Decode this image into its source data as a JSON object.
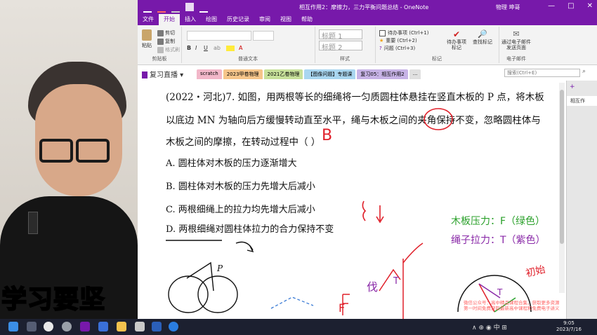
{
  "window": {
    "title": "相互作用2：摩擦力，三力平衡问题总结 - OneNote",
    "user": "物理 坤哥",
    "controls": [
      "—",
      "□",
      "✕"
    ]
  },
  "ribbon_tabs": [
    "文件",
    "开始",
    "插入",
    "绘图",
    "历史记录",
    "审阅",
    "视图",
    "帮助"
  ],
  "ribbon": {
    "paste": "粘贴",
    "cut": "剪切",
    "copy": "复制",
    "format_painter": "格式刷",
    "clipboard_label": "剪贴板",
    "basic_text_label": "普通文本",
    "heading1": "标题 1",
    "heading2": "标题 2",
    "styles_label": "样式",
    "tag1": "待办事项 (Ctrl+1)",
    "tag2": "重要 (Ctrl+2)",
    "tag3": "问题 (Ctrl+3)",
    "todo_tag": "待办事项标记",
    "find_tags": "查找标记",
    "tags_label": "标记",
    "email_page": "通过电子邮件发送页面",
    "email_label": "电子邮件"
  },
  "notebook": {
    "name": "复习直播",
    "sections": [
      {
        "label": "scratch",
        "color": "#f2b7c9"
      },
      {
        "label": "2023甲卷物理",
        "color": "#f6c58a"
      },
      {
        "label": "2021乙卷物理",
        "color": "#c7e09a"
      },
      {
        "label": "【图像问题】专题课",
        "color": "#a9d6f0"
      },
      {
        "label": "复习05：相互作用2",
        "color": "#c7b3e6"
      },
      {
        "label": "...",
        "color": "#e0e0e0"
      }
    ],
    "search_placeholder": "搜索(Ctrl+E)"
  },
  "page": {
    "line1": "(2022・河北)7. 如图，用两根等长的细绳将一匀质圆柱体悬挂在竖直木板的 P 点，将木板",
    "line2": "以底边 MN 为轴向后方缓慢转动直至水平，绳与木板之间的夹角保持不变，忽略圆柱体与",
    "line3": "木板之间的摩擦，在转动过程中（        ）",
    "answer": "B",
    "options": [
      "A.  圆柱体对木板的压力逐渐增大",
      "B.  圆柱体对木板的压力先增大后减小",
      "C.  两根细绳上的拉力均先增大后减小",
      "D.  两根细绳对圆柱体拉力的合力保持不变"
    ],
    "legend_board": "木板压力：F（绿色）",
    "legend_rope": "绳子拉力：T（紫色）",
    "label_P": "P",
    "label_T": "T",
    "label_F": "F",
    "label_initial": "初始",
    "label_dai": "伐"
  },
  "right_pane": {
    "add_page": "+",
    "page_item": "相互作"
  },
  "overlay": {
    "slogan": "学习要坚",
    "notify_line1": "微信公众号：高中精品课程合集，获取更多资源",
    "notify_line2": "第一时间免费获取最新高中课程和免费电子讲义"
  },
  "taskbar": {
    "tray": "∧  ⊕  ◉  中  ⊞",
    "time": "9:05",
    "date": "2023/7/16"
  },
  "colors": {
    "accent": "#7719aa",
    "answer_red": "#e0202a",
    "green": "#2aa02a",
    "purple": "#8a2aa8"
  }
}
